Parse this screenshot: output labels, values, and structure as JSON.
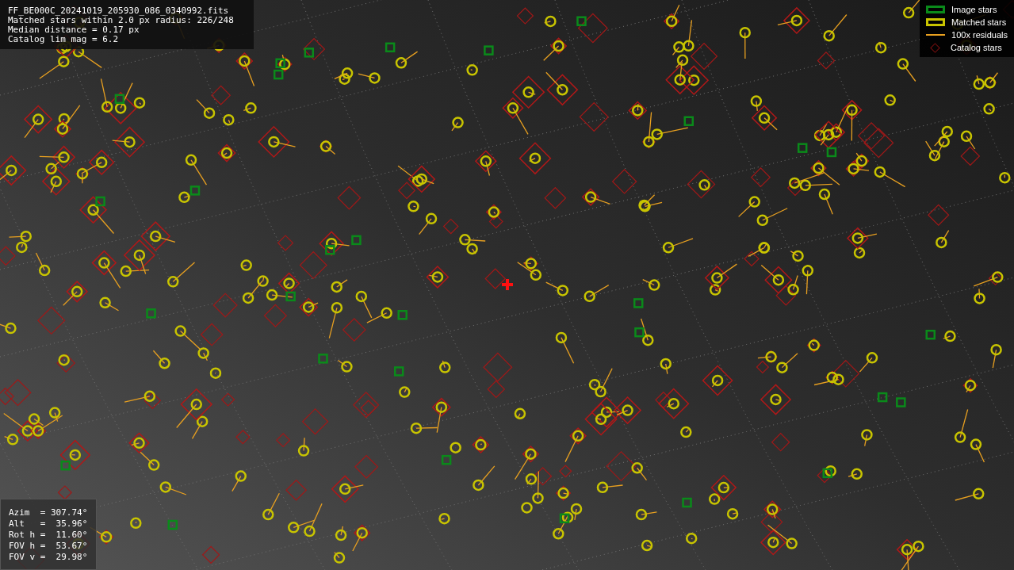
{
  "info_lines": [
    "FF_BE000C_20241019_205930_086_0340992.fits",
    "Matched stars within 2.0 px radius: 226/248",
    "Median distance = 0.17 px",
    "Catalog lim mag = 6.2"
  ],
  "legend": [
    {
      "kind": "image",
      "label": "Image stars"
    },
    {
      "kind": "matched",
      "label": "Matched stars"
    },
    {
      "kind": "residual",
      "label": "100x residuals"
    },
    {
      "kind": "catalog",
      "label": "Catalog stars"
    }
  ],
  "pointing": [
    "Azim  = 307.74°",
    "Alt   =  35.96°",
    "Rot h =  11.60°",
    "FOV h =  53.67°",
    "FOV v =  29.98°"
  ]
}
